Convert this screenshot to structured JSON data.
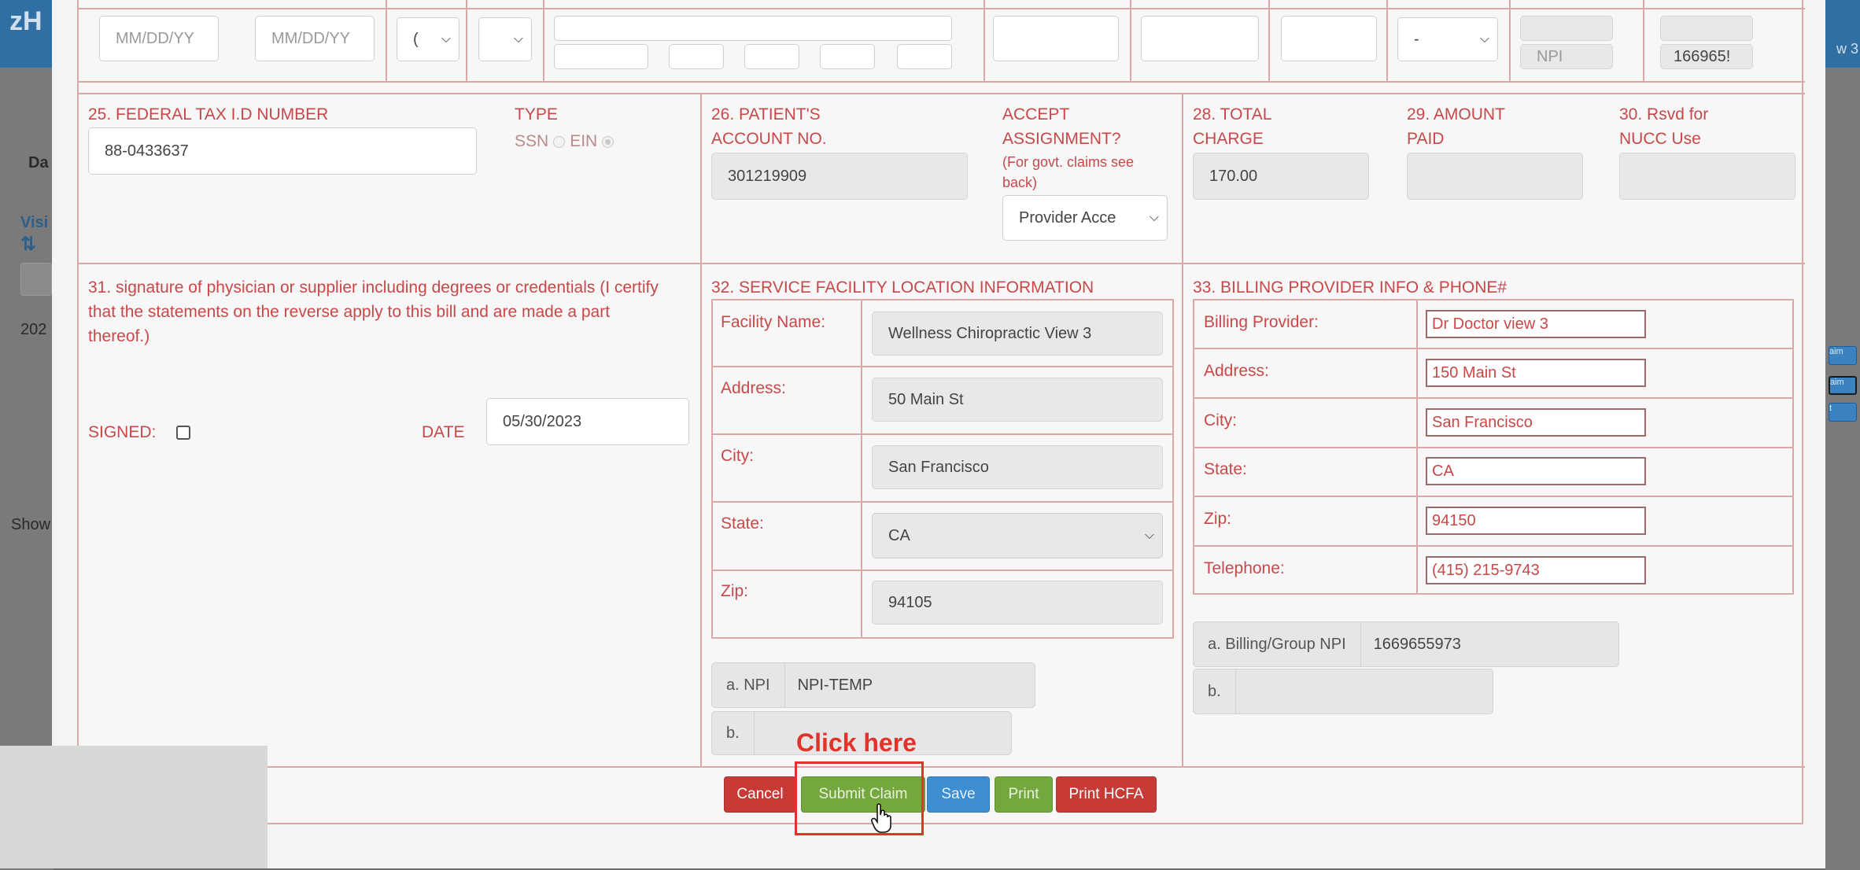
{
  "background": {
    "logo": "zH",
    "top_right_text": "w 3",
    "left_label_da": "Da",
    "left_link_visi": "Visi",
    "left_sort_icon": "sort-arrows-icon",
    "left_year": "202",
    "left_show": "Show",
    "right_buttons": [
      "aim",
      "aim",
      "t"
    ]
  },
  "row24": {
    "date_from_placeholder": "MM/DD/YY",
    "date_to_placeholder": "MM/DD/YY",
    "select1_value": "(",
    "select2_value": "",
    "select_dash": "-",
    "npi_label": "NPI",
    "npi_value": "166965!"
  },
  "box25": {
    "title": "25. FEDERAL TAX I.D NUMBER",
    "value": "88-0433637",
    "type_label": "TYPE",
    "ssn_label": "SSN",
    "ein_label": "EIN"
  },
  "box26": {
    "title_line1": "26. PATIENT'S",
    "title_line2": "ACCOUNT NO.",
    "value": "301219909"
  },
  "box27": {
    "title_line1": "ACCEPT",
    "title_line2": "ASSIGNMENT?",
    "note_line1": "(For govt. claims see",
    "note_line2": "back)",
    "select_value": "Provider Acce"
  },
  "box28": {
    "title_line1": "28. TOTAL",
    "title_line2": "CHARGE",
    "value": "170.00"
  },
  "box29": {
    "title_line1": "29. AMOUNT",
    "title_line2": "PAID",
    "value": ""
  },
  "box30": {
    "title_line1": "30. Rsvd for",
    "title_line2": "NUCC Use",
    "value": ""
  },
  "box31": {
    "line1": "31. signature of physician or supplier including degrees or credentials (I certify",
    "line2": "that the statements on the reverse apply to this bill and are made a part",
    "line3": "thereof.)",
    "signed_label": "SIGNED:",
    "date_label": "DATE",
    "date_value": "05/30/2023"
  },
  "box32": {
    "title": "32. SERVICE FACILITY LOCATION INFORMATION",
    "facility_label": "Facility Name:",
    "facility_value": "Wellness Chiropractic View 3",
    "address_label": "Address:",
    "address_value": "50 Main St",
    "city_label": "City:",
    "city_value": "San Francisco",
    "state_label": "State:",
    "state_value": "CA",
    "zip_label": "Zip:",
    "zip_value": "94105",
    "npi_a_label": "a. NPI",
    "npi_a_value": "NPI-TEMP",
    "npi_b_label": "b.",
    "npi_b_value": ""
  },
  "box33": {
    "title": "33. BILLING PROVIDER INFO & PHONE#",
    "provider_label": "Billing Provider:",
    "provider_value": "Dr Doctor  view 3",
    "address_label": "Address:",
    "address_value": "150 Main St",
    "city_label": "City:",
    "city_value": "San Francisco",
    "state_label": "State:",
    "state_value": "CA",
    "zip_label": "Zip:",
    "zip_value": "94150",
    "phone_label": "Telephone:",
    "phone_value": "(415) 215-9743",
    "group_npi_a_label": "a. Billing/Group NPI",
    "group_npi_a_value": "1669655973",
    "group_npi_b_label": "b.",
    "group_npi_b_value": ""
  },
  "footer": {
    "callout": "Click here",
    "cancel": "Cancel",
    "submit": "Submit Claim",
    "save": "Save",
    "print": "Print",
    "print_hcfa": "Print HCFA"
  },
  "colors": {
    "label_red": "#c8484a",
    "border_pink": "#dba8a8",
    "btn_red": "#c83a35",
    "btn_green": "#74a83e",
    "btn_blue": "#3d8ed1",
    "callout_red": "#e2332a"
  }
}
